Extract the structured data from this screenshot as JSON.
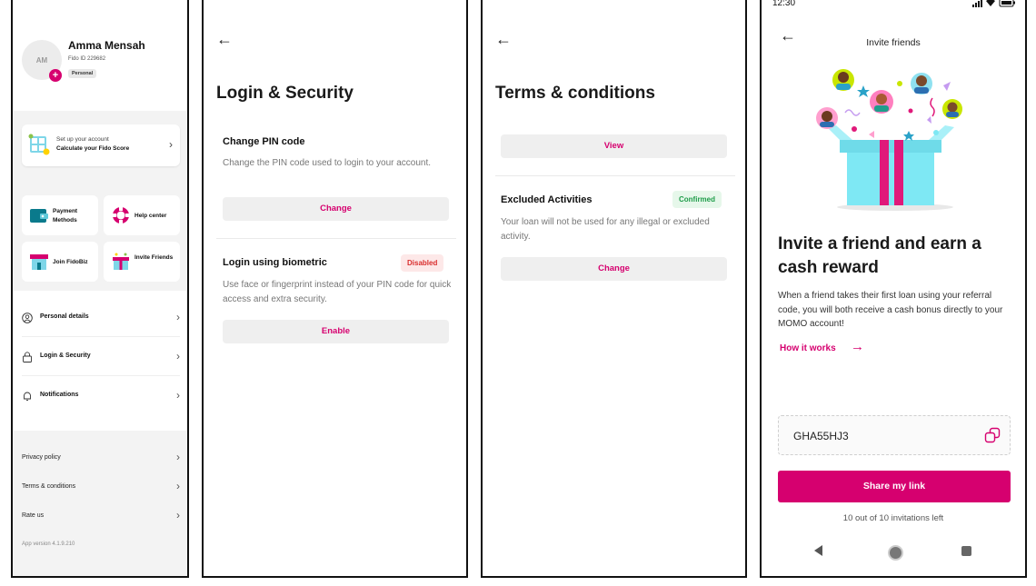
{
  "profile_screen": {
    "avatar_initials": "AM",
    "user_name": "Amma Mensah",
    "fido_id": "Fido ID 229682",
    "account_type": "Personal",
    "setup_card": {
      "line1": "Set up your account",
      "line2": "Calculate your Fido Score"
    },
    "tiles": [
      {
        "label": "Payment Methods"
      },
      {
        "label": "Help center"
      },
      {
        "label": "Join FidoBiz"
      },
      {
        "label": "Invite Friends"
      }
    ],
    "menu": [
      {
        "label": "Personal details"
      },
      {
        "label": "Login & Security"
      },
      {
        "label": "Notifications"
      }
    ],
    "links": [
      {
        "label": "Privacy policy"
      },
      {
        "label": "Terms & conditions"
      },
      {
        "label": "Rate us"
      }
    ],
    "app_version": "App version 4.1.9.210"
  },
  "security_screen": {
    "title": "Login & Security",
    "pin_section": {
      "title": "Change PIN code",
      "description": "Change the PIN code used to login to your account.",
      "button": "Change"
    },
    "biometric_section": {
      "title": "Login using biometric",
      "status": "Disabled",
      "description": "Use face or fingerprint instead of your PIN code for quick access and extra security.",
      "button": "Enable"
    }
  },
  "terms_screen": {
    "title": "Terms & conditions",
    "view_button": "View",
    "excluded_section": {
      "title": "Excluded Activities",
      "status": "Confirmed",
      "description": "Your loan will not be used for any illegal or excluded activity.",
      "button": "Change"
    }
  },
  "invite_screen": {
    "status_time": "12:30",
    "title": "Invite friends",
    "heading": "Invite a friend and earn a cash reward",
    "description": "When a friend takes their first loan using your referral code, you will both receive a cash bonus directly to your MOMO account!",
    "how_link": "How it works",
    "referral_code": "GHA55HJ3",
    "share_button": "Share my link",
    "invitations_left": "10 out of 10 invitations left"
  },
  "colors": {
    "accent": "#d6006f",
    "disabled_bg": "#fde8e8",
    "disabled_text": "#d92d2d",
    "confirmed_bg": "#e6f7ea",
    "confirmed_text": "#1f9d4a"
  }
}
